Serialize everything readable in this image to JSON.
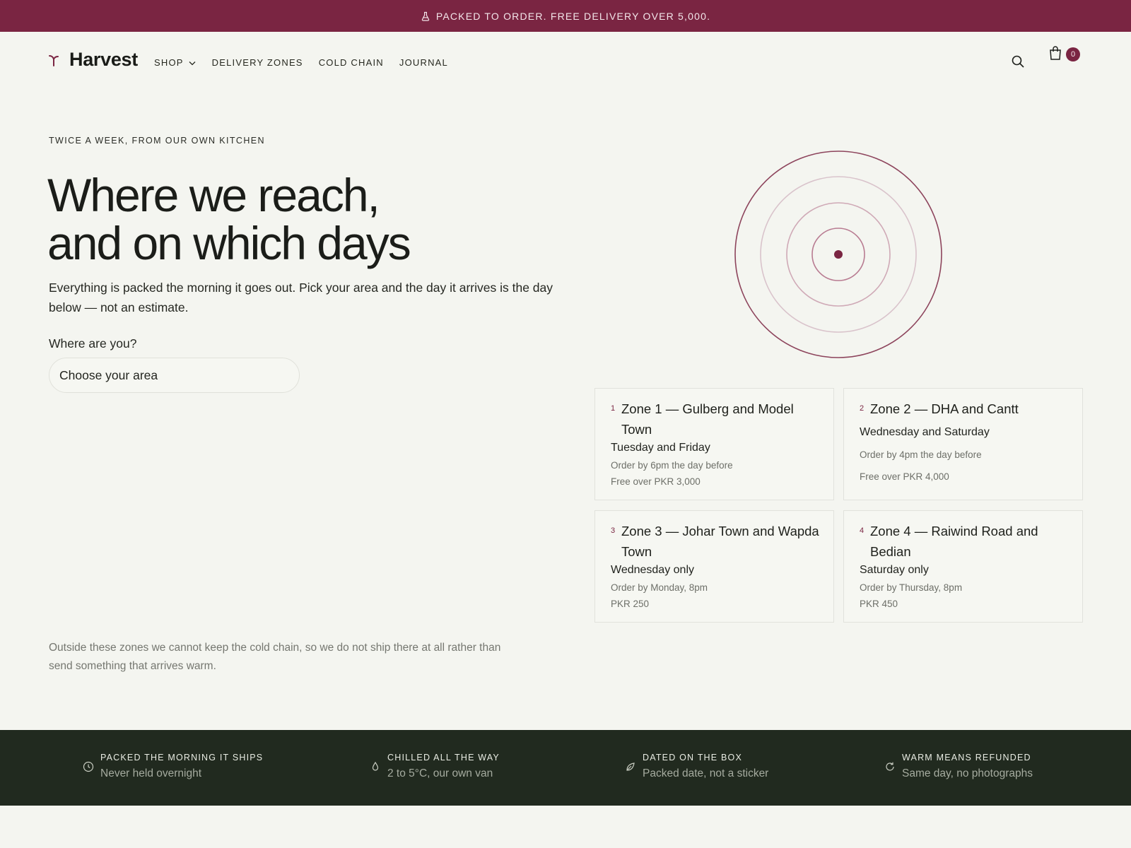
{
  "announcement": {
    "text": "PACKED TO ORDER. FREE DELIVERY OVER 5,000.",
    "icon": "flask-icon"
  },
  "header": {
    "brand": "Harvest",
    "nav": [
      {
        "label": "SHOP",
        "has_dropdown": true
      },
      {
        "label": "DELIVERY ZONES"
      },
      {
        "label": "COLD CHAIN"
      },
      {
        "label": "JOURNAL"
      }
    ],
    "cart_count": "0"
  },
  "hero": {
    "eyebrow": "TWICE A WEEK, FROM OUR OWN KITCHEN",
    "headline_line1": "Where we reach,",
    "headline_line2": "and on which days",
    "intro": "Everything is packed the morning it goes out. Pick your area and the day it arrives is the day below — not an estimate.",
    "area_label": "Where are you?",
    "area_select_value": "Choose your area",
    "outside_note": "Outside these zones we cannot keep the cold chain, so we do not ship there at all rather than send something that arrives warm."
  },
  "zones": [
    {
      "num": "1",
      "name": "Zone 1 — Gulberg and Model Town",
      "day": "Tuesday and Friday",
      "cutoff": "Order by 6pm the day before",
      "price": "Free over PKR 3,000"
    },
    {
      "num": "2",
      "name": "Zone 2 — DHA and Cantt",
      "day": "Wednesday and Saturday",
      "cutoff": "Order by 4pm the day before",
      "price": "Free over PKR 4,000"
    },
    {
      "num": "3",
      "name": "Zone 3 — Johar Town and Wapda Town",
      "day": "Wednesday only",
      "cutoff": "Order by Monday, 8pm",
      "price": "PKR 250"
    },
    {
      "num": "4",
      "name": "Zone 4 — Raiwind Road and Bedian",
      "day": "Saturday only",
      "cutoff": "Order by Thursday, 8pm",
      "price": "PKR 450"
    }
  ],
  "features": [
    {
      "icon": "clock-icon",
      "title": "PACKED THE MORNING IT SHIPS",
      "sub": "Never held overnight"
    },
    {
      "icon": "droplet-icon",
      "title": "CHILLED ALL THE WAY",
      "sub": "2 to 5°C, our own van"
    },
    {
      "icon": "leaf-icon",
      "title": "DATED ON THE BOX",
      "sub": "Packed date, not a sticker"
    },
    {
      "icon": "refresh-icon",
      "title": "WARM MEANS REFUNDED",
      "sub": "Same day, no photographs"
    }
  ],
  "colors": {
    "accent": "#7a2542",
    "background": "#f4f5f0",
    "strip": "#212a1f"
  }
}
